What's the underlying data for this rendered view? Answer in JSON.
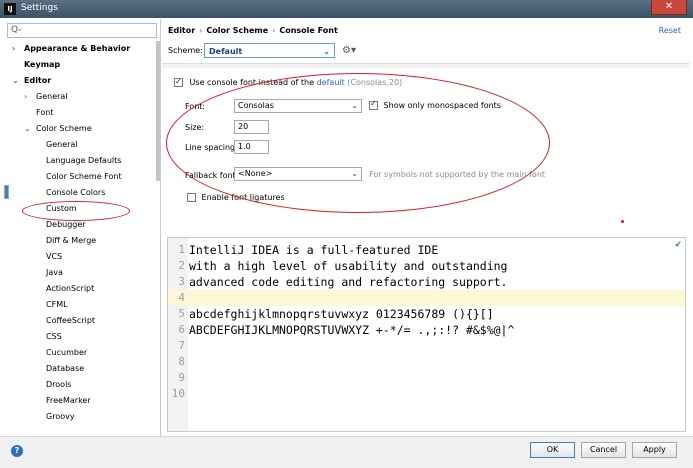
{
  "window": {
    "title": "Settings",
    "app_icon": "IJ",
    "close_symbol": "✕"
  },
  "sidebar": {
    "search_placeholder": "Q-",
    "items": [
      {
        "label": "Appearance & Behavior",
        "level": 0,
        "arrow": "›",
        "bold": true
      },
      {
        "label": "Keymap",
        "level": 0,
        "arrow": "",
        "bold": true
      },
      {
        "label": "Editor",
        "level": 0,
        "arrow": "⌄",
        "bold": true
      },
      {
        "label": "General",
        "level": 1,
        "arrow": "›"
      },
      {
        "label": "Font",
        "level": 1,
        "arrow": ""
      },
      {
        "label": "Color Scheme",
        "level": 1,
        "arrow": "⌄"
      },
      {
        "label": "General",
        "level": 2
      },
      {
        "label": "Language Defaults",
        "level": 2
      },
      {
        "label": "Color Scheme Font",
        "level": 2
      },
      {
        "label": "Console Font",
        "level": 2,
        "selected": true
      },
      {
        "label": "Console Colors",
        "level": 2
      },
      {
        "label": "Custom",
        "level": 2
      },
      {
        "label": "Debugger",
        "level": 2
      },
      {
        "label": "Diff & Merge",
        "level": 2
      },
      {
        "label": "VCS",
        "level": 2
      },
      {
        "label": "Java",
        "level": 2
      },
      {
        "label": "ActionScript",
        "level": 2
      },
      {
        "label": "CFML",
        "level": 2
      },
      {
        "label": "CoffeeScript",
        "level": 2
      },
      {
        "label": "CSS",
        "level": 2
      },
      {
        "label": "Cucumber",
        "level": 2
      },
      {
        "label": "Database",
        "level": 2
      },
      {
        "label": "Drools",
        "level": 2
      },
      {
        "label": "FreeMarker",
        "level": 2
      },
      {
        "label": "Groovy",
        "level": 2
      }
    ]
  },
  "breadcrumb": [
    "Editor",
    "Color Scheme",
    "Console Font"
  ],
  "breadcrumb_sep": "›",
  "reset_label": "Reset",
  "scheme": {
    "label": "Scheme:",
    "value": "Default"
  },
  "console_font": {
    "use_console_font_label": "Use console font instead of the",
    "default_link": "default",
    "default_hint": "(Consolas,20)",
    "use_console_font_checked": true,
    "font_label": "Font:",
    "font_value": "Consolas",
    "monospaced_label": "Show only monospaced fonts",
    "monospaced_checked": true,
    "size_label": "Size:",
    "size_value": "20",
    "line_spacing_label": "Line spacing:",
    "line_spacing_value": "1.0",
    "fallback_label": "Fallback font:",
    "fallback_value": "<None>",
    "fallback_hint": "For symbols not supported by the main font",
    "ligatures_label": "Enable font ligatures",
    "ligatures_checked": false
  },
  "preview": {
    "lines": [
      {
        "n": "1",
        "text": "IntelliJ IDEA is a full-featured IDE"
      },
      {
        "n": "2",
        "text": "with a high level of usability and outstanding"
      },
      {
        "n": "3",
        "text": "advanced code editing and refactoring support."
      },
      {
        "n": "4",
        "text": "",
        "current": true
      },
      {
        "n": "5",
        "text": "abcdefghijklmnopqrstuvwxyz 0123456789 (){}[]"
      },
      {
        "n": "6",
        "text": "ABCDEFGHIJKLMNOPQRSTUVWXYZ +-*/= .,;:!? #&$%@|^"
      },
      {
        "n": "7",
        "text": ""
      },
      {
        "n": "8",
        "text": ""
      },
      {
        "n": "9",
        "text": ""
      },
      {
        "n": "10",
        "text": ""
      }
    ]
  },
  "buttons": {
    "ok": "OK",
    "cancel": "Cancel",
    "apply": "Apply",
    "help": "?"
  },
  "colors": {
    "selection": "#3d7fc6",
    "annotation": "#d81e1e",
    "link": "#2a62c9"
  }
}
